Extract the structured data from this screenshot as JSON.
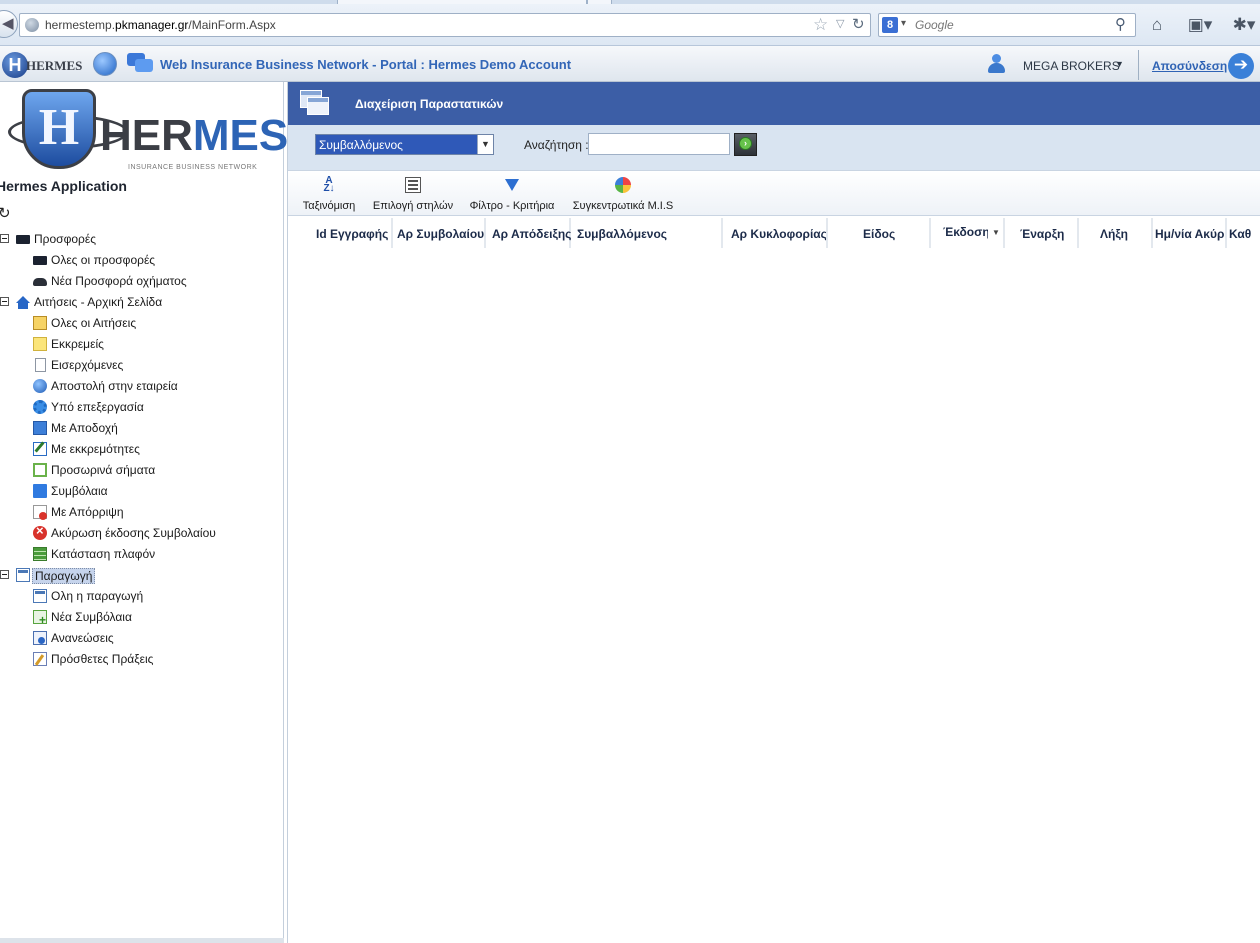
{
  "browser": {
    "url_prefix": "hermestemp.",
    "url_domain": "pkmanager.gr",
    "url_path": "/MainForm.Aspx",
    "search_engine_letter": "8",
    "search_placeholder": "Google"
  },
  "header": {
    "logo_text": "HERMES",
    "portal_title": "Web Insurance Business Network - Portal : Hermes Demo Account",
    "broker_name": "MEGA BROKERS",
    "logout_label": "Αποσύνδεση"
  },
  "sidebar": {
    "logo_word_a": "HER",
    "logo_word_b": "MES",
    "logo_sub": "INSURANCE BUSINESS NETWORK",
    "app_name": "Hermes Application",
    "tree": {
      "offers": "Προσφορές",
      "all_offers": "Ολες οι προσφορές",
      "new_vehicle_offer": "Νέα Προσφορά οχήματος",
      "requests_home": "Αιτήσεις - Αρχική Σελίδα",
      "all_requests": "Ολες οι Αιτήσεις",
      "pending": "Εκκρεμείς",
      "incoming": "Εισερχόμενες",
      "sent_to_company": "Αποστολή στην εταιρεία",
      "in_process": "Υπό επεξεργασία",
      "accepted": "Με Αποδοχή",
      "with_pending": "Με εκκρεμότητες",
      "temp_signals": "Προσωρινά σήματα",
      "contracts": "Συμβόλαια",
      "rejected": "Με Απόρριψη",
      "cancel_issue": "Ακύρωση έκδοσης Συμβολαίου",
      "ceiling_status": "Κατάσταση πλαφόν",
      "production": "Παραγωγή",
      "all_production": "Ολη η παραγωγή",
      "new_contracts": "Νέα Συμβόλαια",
      "renewals": "Ανανεώσεις",
      "additional_acts": "Πρόσθετες Πράξεις"
    }
  },
  "main": {
    "title": "Διαχείριση Παραστατικών",
    "filter_select_value": "Συμβαλλόμενος",
    "search_label": "Αναζήτηση :",
    "search_value": "",
    "toolbar": {
      "sort": "Ταξινόμιση",
      "select_columns": "Επιλογή στηλών",
      "filter": "Φίλτρο - Κριτήρια",
      "mis": "Συγκεντρωτικά M.I.S"
    },
    "columns": [
      "Id Εγγραφής",
      "Αρ Συμβολαίου",
      "Αρ Απόδειξης",
      "Συμβαλλόμενος",
      "Αρ Κυκλοφορίας",
      "Είδος",
      "Έκδοση",
      "Έναρξη",
      "Λήξη",
      "Ημ/νία Ακύρ",
      "Καθ"
    ]
  },
  "colors": {
    "panel_title_bg": "#3c5ea6",
    "filter_row_bg": "#d9e4f1",
    "link_blue": "#2f63b4"
  }
}
